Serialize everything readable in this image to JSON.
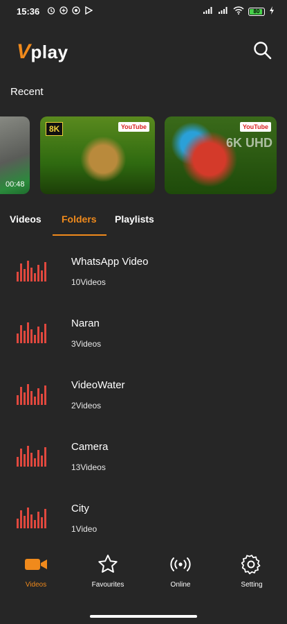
{
  "status_bar": {
    "time": "15:36",
    "battery": "80"
  },
  "app": {
    "logo_letter": "V",
    "logo_rest": "play"
  },
  "recent": {
    "title": "Recent",
    "items": [
      {
        "duration": "00:48"
      },
      {
        "badge": "8K",
        "tag": "YouTube"
      },
      {
        "tag": "YouTube",
        "overlay": "6K UHD"
      }
    ]
  },
  "tabs": [
    {
      "label": "Videos"
    },
    {
      "label": "Folders"
    },
    {
      "label": "Playlists"
    }
  ],
  "folders": [
    {
      "name": "WhatsApp Video",
      "count": "10Videos"
    },
    {
      "name": "Naran",
      "count": "3Videos"
    },
    {
      "name": "VideoWater",
      "count": "2Videos"
    },
    {
      "name": "Camera",
      "count": "13Videos"
    },
    {
      "name": "City",
      "count": "1Video"
    }
  ],
  "bottom_nav": [
    {
      "label": "Videos",
      "icon": "video-camera-icon"
    },
    {
      "label": "Favourites",
      "icon": "star-icon"
    },
    {
      "label": "Online",
      "icon": "broadcast-icon"
    },
    {
      "label": "Setting",
      "icon": "gear-icon"
    }
  ],
  "colors": {
    "accent": "#f08a1c",
    "background": "#262626",
    "bars": "#e0483e"
  }
}
